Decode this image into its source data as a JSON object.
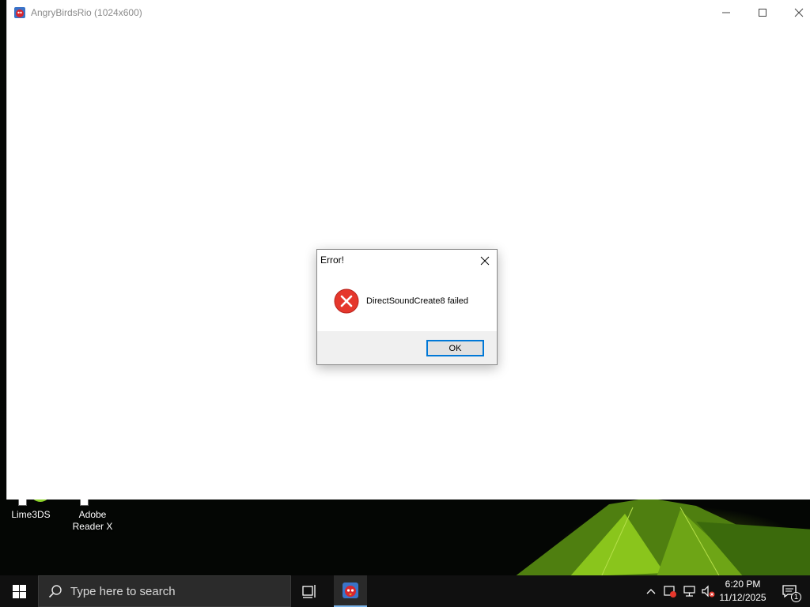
{
  "window": {
    "title": "AngryBirdsRio (1024x600)"
  },
  "dialog": {
    "title": "Error!",
    "message": "DirectSoundCreate8 failed",
    "ok_label": "OK",
    "icon": "error-icon",
    "icon_color": "#e5372c"
  },
  "desktop": {
    "icons": [
      {
        "label": "Lime3DS",
        "icon": "lime3ds-icon"
      },
      {
        "label": "Adobe Reader X",
        "icon": "adobe-reader-icon"
      }
    ]
  },
  "taskbar": {
    "search_placeholder": "Type here to search",
    "time": "6:20 PM",
    "date": "11/12/2025",
    "notification_count": "1",
    "accent": "#7ab4ea"
  }
}
